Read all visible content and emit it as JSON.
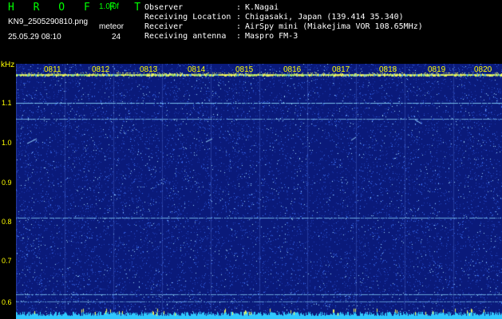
{
  "header": {
    "app_title": "H R O F F T",
    "version": "1.0.0f",
    "filename": "KN9_2505290810.png",
    "meteor_label": "meteor",
    "timestamp": "25.05.29 08:10",
    "count": "24",
    "fields": [
      {
        "label": "Observer",
        "value": "K.Nagai"
      },
      {
        "label": "Receiving Location",
        "value": "Chigasaki, Japan (139.414 35.340)"
      },
      {
        "label": "Receiver",
        "value": "AirSpy mini (Miakejima VOR 108.65MHz)"
      },
      {
        "label": "Receiving antenna",
        "value": "Maspro FM-3"
      }
    ]
  },
  "spectrogram": {
    "y_unit": "kHz",
    "y_ticks": [
      "1.1",
      "1.0",
      "0.9",
      "0.8",
      "0.7",
      "0.6"
    ],
    "time_labels": [
      "0811",
      "0812",
      "0813",
      "0814",
      "0815",
      "0816",
      "0817",
      "0818",
      "0819",
      "0820"
    ],
    "colors": {
      "background": "#0a1a7a",
      "noise": "#3a6ef0",
      "bright": "#9ad8ff",
      "signal": "#e8f060",
      "label": "#ffff00",
      "baseline": "#30c8ff"
    }
  }
}
